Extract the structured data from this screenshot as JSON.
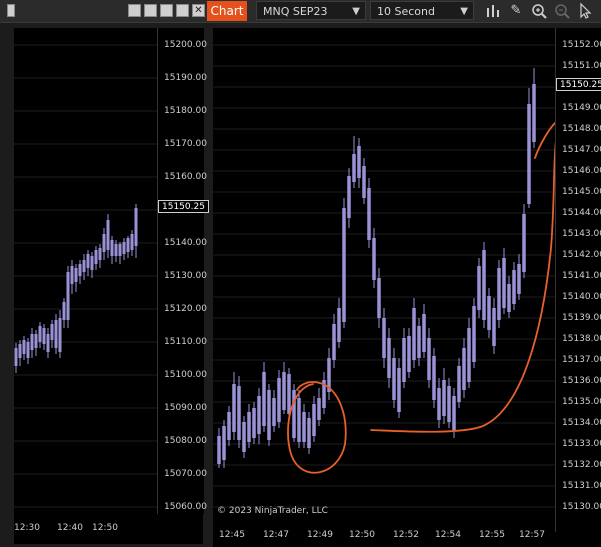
{
  "toolbar": {
    "chart_tab": "Chart",
    "instrument": "MNQ SEP23",
    "interval": "10 Second",
    "tools": [
      {
        "name": "bar-chart-icon"
      },
      {
        "name": "draw-pencil-icon"
      },
      {
        "name": "zoom-in-icon"
      },
      {
        "name": "zoom-out-icon"
      },
      {
        "name": "pointer-icon"
      }
    ]
  },
  "left_panel": {
    "price_ticks": [
      "15200.00",
      "15190.00",
      "15180.00",
      "15170.00",
      "15160.00",
      "15150.00",
      "15140.00",
      "15130.00",
      "15120.00",
      "15110.00",
      "15100.00",
      "15090.00",
      "15080.00",
      "15070.00",
      "15060.00"
    ],
    "current_price": "15150.25",
    "time_labels": [
      "12:30",
      "12:40",
      "12:50"
    ]
  },
  "right_panel": {
    "price_ticks": [
      "15152.00",
      "15151.00",
      "15150.00",
      "15149.00",
      "15148.00",
      "15147.00",
      "15146.00",
      "15145.00",
      "15144.00",
      "15143.00",
      "15142.00",
      "15141.00",
      "15140.00",
      "15139.00",
      "15138.00",
      "15137.00",
      "15136.00",
      "15135.00",
      "15134.00",
      "15133.00",
      "15132.00",
      "15131.00",
      "15130.00"
    ],
    "current_price": "15150.25",
    "time_labels": [
      "12:45",
      "12:47",
      "12:49",
      "12:50",
      "12:52",
      "12:54",
      "12:55",
      "12:57"
    ],
    "copyright": "© 2023 NinjaTrader, LLC"
  },
  "colors": {
    "candle": "#9a92d6",
    "annotation": "#e8602c",
    "accent": "#e4511b"
  }
}
